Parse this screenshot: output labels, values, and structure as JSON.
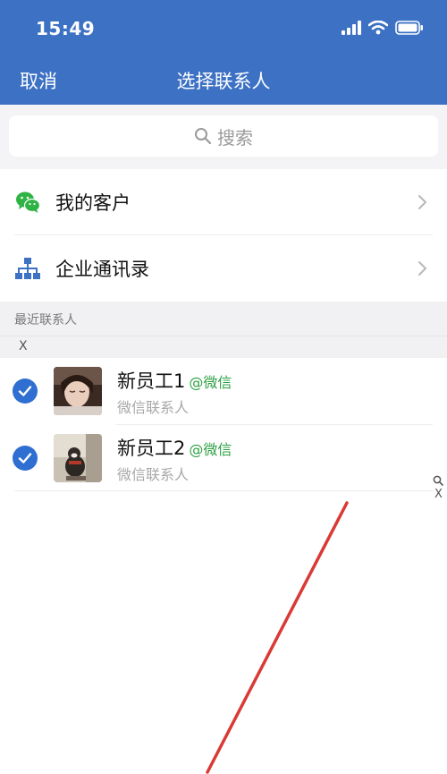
{
  "status_bar": {
    "time": "15:49"
  },
  "nav": {
    "cancel_label": "取消",
    "title": "选择联系人"
  },
  "search": {
    "placeholder": "搜索"
  },
  "menu": [
    {
      "label": "我的客户",
      "icon": "wechat-icon"
    },
    {
      "label": "企业通讯录",
      "icon": "org-chart-icon"
    }
  ],
  "recent": {
    "title": "最近联系人",
    "index_letter": "X",
    "contacts": [
      {
        "name": "新员工1",
        "tag": "@微信",
        "subtitle": "微信联系人",
        "selected": true
      },
      {
        "name": "新员工2",
        "tag": "@微信",
        "subtitle": "微信联系人",
        "selected": true
      }
    ]
  },
  "index_bar": {
    "letter": "X"
  },
  "colors": {
    "header": "#3d71c4",
    "check": "#2f6fd1",
    "wechat_green": "#2ea043",
    "annotation_arrow": "#d93a36"
  }
}
